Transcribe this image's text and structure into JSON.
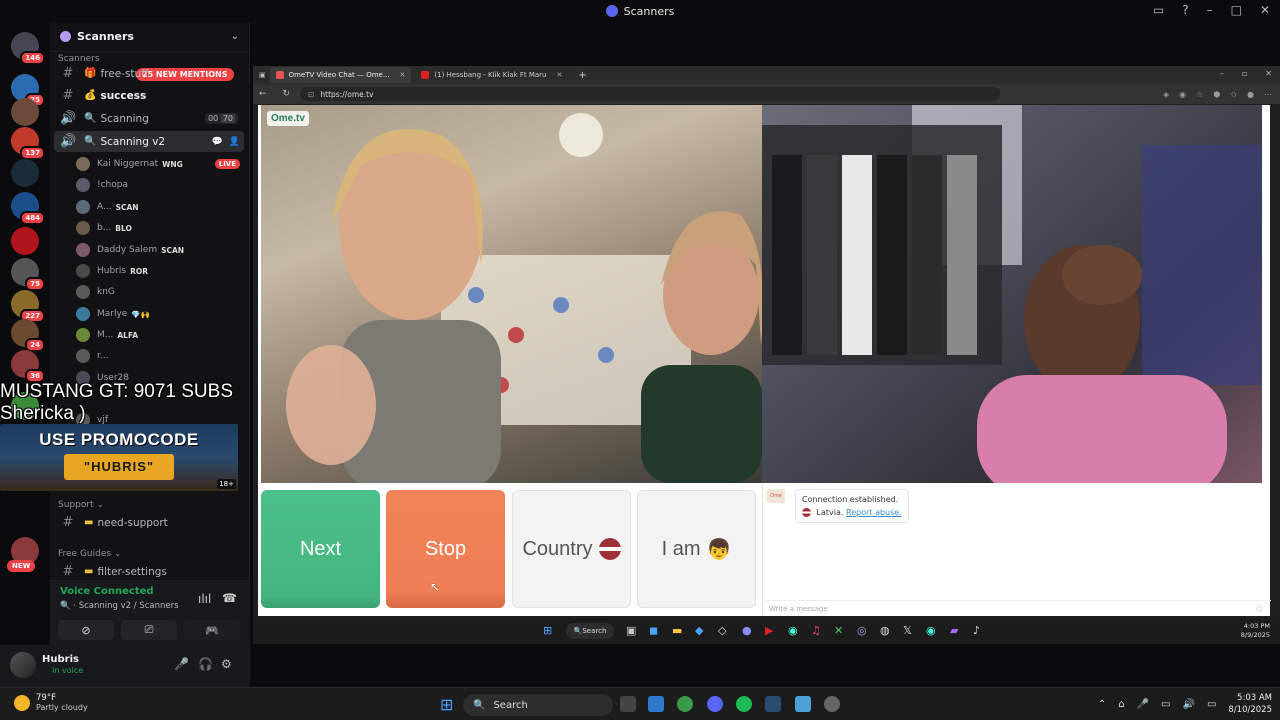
{
  "window": {
    "title": "Scanners"
  },
  "server_rail": {
    "servers": [
      {
        "name": "home",
        "badge": "146",
        "color": "#444654"
      },
      {
        "name": "server-2",
        "badge": "25",
        "color": "#2b6cb0"
      },
      {
        "name": "server-3",
        "badge": "",
        "color": "#6b4a3a"
      },
      {
        "name": "server-4",
        "badge": "137",
        "color": "#c0392b"
      },
      {
        "name": "stake",
        "badge": "",
        "color": "#1a2c38"
      },
      {
        "name": "server-6",
        "badge": "484",
        "color": "#1a4f8b"
      },
      {
        "name": "server-7",
        "badge": "",
        "color": "#b0141c"
      },
      {
        "name": "server-8",
        "badge": "75",
        "color": "#555"
      },
      {
        "name": "server-9",
        "badge": "227",
        "color": "#8a6a2a"
      },
      {
        "name": "server-10",
        "badge": "24",
        "color": "#6a4a30"
      },
      {
        "name": "server-11",
        "badge": "36",
        "color": "#8a3a3a"
      },
      {
        "name": "server-12",
        "badge": "",
        "color": "#3a8a3a"
      },
      {
        "name": "server-13",
        "badge": "",
        "color": "#8a3a3a"
      }
    ],
    "new_badge": "NEW"
  },
  "sidebar": {
    "server_name": "Scanners",
    "category_top": "Scanners",
    "mentions_pill": "25 NEW MENTIONS",
    "channels": [
      {
        "label": "free-stuff",
        "emoji": "🎁",
        "type": "text"
      },
      {
        "label": "success",
        "emoji": "💰",
        "type": "text"
      },
      {
        "label": "Scanning",
        "emoji": "🔍",
        "type": "voice",
        "count": "00",
        "limit": "70"
      },
      {
        "label": "Scanning v2",
        "emoji": "🔍",
        "type": "voice"
      }
    ],
    "members": [
      {
        "name": "Kai Niggernat",
        "tag": "WNG",
        "live": "LIVE",
        "color": "#7a6a5a"
      },
      {
        "name": "!chopa",
        "tag": "",
        "color": "#5a5a6a"
      },
      {
        "name": "A...",
        "tag": "SCAN",
        "color": "#5a6a7a"
      },
      {
        "name": "b...",
        "tag": "BLO",
        "color": "#6a5a4a"
      },
      {
        "name": "Daddy Salem",
        "tag": "SCAN",
        "color": "#7a5a6a"
      },
      {
        "name": "Hubris",
        "tag": "ROR",
        "color": "#4a4a4a"
      },
      {
        "name": "knG",
        "tag": "",
        "color": "#5a5a5a"
      },
      {
        "name": "Marlye",
        "tag": "💎🙌",
        "color": "#3a7a9a"
      },
      {
        "name": "M...",
        "tag": "ALFA",
        "color": "#6a8a3a"
      },
      {
        "name": "r...",
        "tag": "",
        "color": "#5a5a5a"
      },
      {
        "name": "User28",
        "tag": "",
        "color": "#4a4a5a"
      },
      {
        "name": "vjf",
        "tag": "",
        "color": "#5a5a5a"
      }
    ],
    "category_support": "Support",
    "support_channel": "need-support",
    "category_guides": "Free Guides",
    "guides_channel": "filter-settings"
  },
  "overlay": {
    "line1": "MUSTANG GT: 9071 SUBS",
    "line2": "Shericka )",
    "promo_line1": "USE PROMOCODE",
    "promo_code": "\"HUBRIS\"",
    "age": "18+"
  },
  "voice_panel": {
    "status": "Voice Connected",
    "channel": "Scanning v2 / Scanners"
  },
  "user_panel": {
    "name": "Hubris",
    "status": "In voice"
  },
  "browser": {
    "tabs": [
      {
        "label": "OmeTV Video Chat — Ome...",
        "active": true,
        "color": "#e05555"
      },
      {
        "label": "(1) Hessbang - Klik Klak Ft Maru",
        "active": false,
        "color": "#e02020"
      }
    ],
    "url": "https://ome.tv"
  },
  "ometv": {
    "logo": "Ome.tv",
    "buttons": {
      "next": "Next",
      "stop": "Stop",
      "country": "Country",
      "iam": "I am"
    },
    "chat": {
      "message": "Connection established.",
      "country": "Latvia.",
      "report": "Report abuse.",
      "input_placeholder": "Write a message"
    }
  },
  "inner_taskbar": {
    "search": "Search",
    "time": "4:03 PM",
    "date": "8/9/2025"
  },
  "taskbar": {
    "weather_temp": "79°F",
    "weather_desc": "Partly cloudy",
    "search": "Search",
    "time": "5:03 AM",
    "date": "8/10/2025"
  }
}
